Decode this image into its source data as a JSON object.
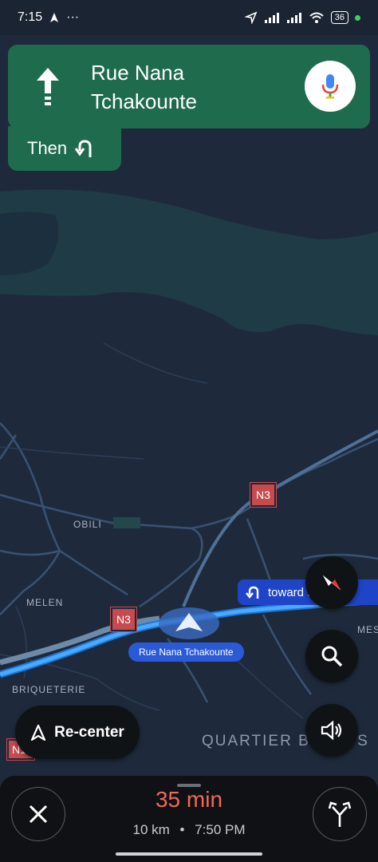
{
  "status_bar": {
    "time": "7:15",
    "overflow": "···",
    "battery": "36"
  },
  "nav": {
    "street": "Rue Nana Tchakounte",
    "then_label": "Then",
    "icons": {
      "maneuver": "straight-arrow-icon",
      "then": "u-turn-left-icon",
      "mic": "microphone-icon"
    }
  },
  "map": {
    "labels": {
      "obili": "OBILI",
      "melen": "MELEN",
      "briqueterie": "BRIQUETERIE",
      "quartier": "QUARTIER BASTOS",
      "mes": "MES"
    },
    "shields": {
      "n3_top": "N3",
      "n3_mid": "N3",
      "n1": "N1"
    },
    "current_street": "Rue Nana Tchakounte",
    "toward_text": "toward Nana"
  },
  "controls": {
    "recenter_label": "Re-center"
  },
  "trip": {
    "duration": "35 min",
    "distance": "10 km",
    "separator": "•",
    "arrival": "7:50 PM"
  },
  "colors": {
    "nav_green": "#1f6b4e",
    "route_blue": "#4aa8ff",
    "eta_red": "#f06a5b"
  }
}
